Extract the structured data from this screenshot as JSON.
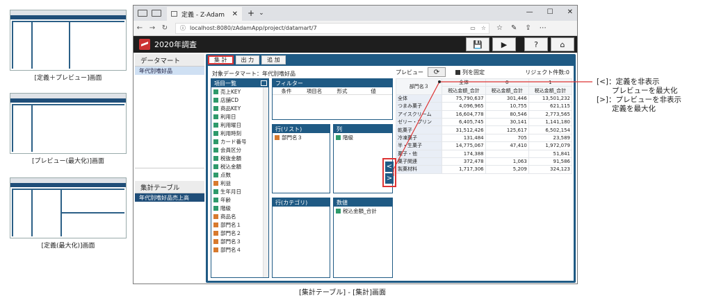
{
  "thumbnails": [
    {
      "caption": "[定義＋プレビュー]画面"
    },
    {
      "caption": "[プレビュー(最大化)]画面"
    },
    {
      "caption": "[定義(最大化)]画面"
    }
  ],
  "browser": {
    "tab_title": "定義 - Z-Adam",
    "url": "localhost:8080/zAdamApp/project/datamart/7",
    "window_controls": [
      "—",
      "☐",
      "✕"
    ]
  },
  "app": {
    "title": "2020年調査",
    "buttons": [
      "💾",
      "▶",
      "?",
      "⌂"
    ]
  },
  "left_pane": {
    "datamart_head": "データマート",
    "datamart_selected": "年代別嗜好品",
    "aggregate_head": "集計テーブル",
    "aggregate_selected": "年代別嗜好品売上高"
  },
  "work_tabs": [
    "集 計",
    "出 力",
    "追 加"
  ],
  "target_label": "対象データマート：年代別嗜好品",
  "field_list": {
    "head": "項目一覧",
    "items": [
      {
        "label": "売上KEY",
        "color": "g"
      },
      {
        "label": "店舗CD",
        "color": "g"
      },
      {
        "label": "商品KEY",
        "color": "g"
      },
      {
        "label": "利用日",
        "color": "g"
      },
      {
        "label": "利用曜日",
        "color": "g"
      },
      {
        "label": "利用時刻",
        "color": "g"
      },
      {
        "label": "カード番号",
        "color": "g"
      },
      {
        "label": "会員区分",
        "color": "g"
      },
      {
        "label": "税抜金額",
        "color": "g"
      },
      {
        "label": "税込金額",
        "color": "g"
      },
      {
        "label": "点数",
        "color": "g"
      },
      {
        "label": "利益",
        "color": "o"
      },
      {
        "label": "生年月日",
        "color": "g"
      },
      {
        "label": "年齢",
        "color": "g"
      },
      {
        "label": "階級",
        "color": "g"
      },
      {
        "label": "商品名",
        "color": "o"
      },
      {
        "label": "部門名１",
        "color": "o"
      },
      {
        "label": "部門名２",
        "color": "o"
      },
      {
        "label": "部門名３",
        "color": "o"
      },
      {
        "label": "部門名４",
        "color": "o"
      }
    ]
  },
  "filter": {
    "head": "フィルター",
    "columns": [
      "条件",
      "項目名",
      "形式",
      "値"
    ]
  },
  "row_list": {
    "head": "行(リスト)",
    "item": "部門名３"
  },
  "col": {
    "head": "列",
    "item": "階級"
  },
  "row_cat": {
    "head": "行(カテゴリ)"
  },
  "values": {
    "head": "数値",
    "item": "税込金額_合計"
  },
  "preview": {
    "label": "プレビュー",
    "refresh": "⟳",
    "fix_cols": "列を固定",
    "reject": "リジェクト件数:0",
    "row_header": "部門名３",
    "col_keys": [
      "全体",
      "0",
      "1"
    ],
    "col_names": [
      "税込金額_合計",
      "税込金額_合計",
      "税込金額_合計"
    ],
    "rows": [
      {
        "name": "全体",
        "v": [
          "75,790,637",
          "301,446",
          "13,501,232"
        ]
      },
      {
        "name": "つまみ菓子",
        "v": [
          "4,096,965",
          "10,755",
          "621,115"
        ]
      },
      {
        "name": "アイスクリーム",
        "v": [
          "16,604,778",
          "80,546",
          "2,773,565"
        ]
      },
      {
        "name": "ゼリー・プリン",
        "v": [
          "6,405,745",
          "30,141",
          "1,141,180"
        ]
      },
      {
        "name": "乾菓子",
        "v": [
          "31,512,426",
          "125,617",
          "6,502,154"
        ]
      },
      {
        "name": "冷凍菓子",
        "v": [
          "131,484",
          "705",
          "23,589"
        ]
      },
      {
        "name": "半・生菓子",
        "v": [
          "14,775,067",
          "47,410",
          "1,972,079"
        ]
      },
      {
        "name": "菓子・他",
        "v": [
          "174,388",
          "",
          "51,841"
        ]
      },
      {
        "name": "菓子関連",
        "v": [
          "372,478",
          "1,063",
          "91,586"
        ]
      },
      {
        "name": "製菓材料",
        "v": [
          "1,717,306",
          "5,209",
          "324,123"
        ]
      }
    ]
  },
  "arrows": {
    "left": "<",
    "right": ">"
  },
  "caption": "[集計テーブル] - [集計]画面",
  "annotation": {
    "l1": "[<]：定義を非表示",
    "l2": "プレビューを最大化",
    "l3": "[>]：プレビューを非表示",
    "l4": "定義を最大化"
  }
}
